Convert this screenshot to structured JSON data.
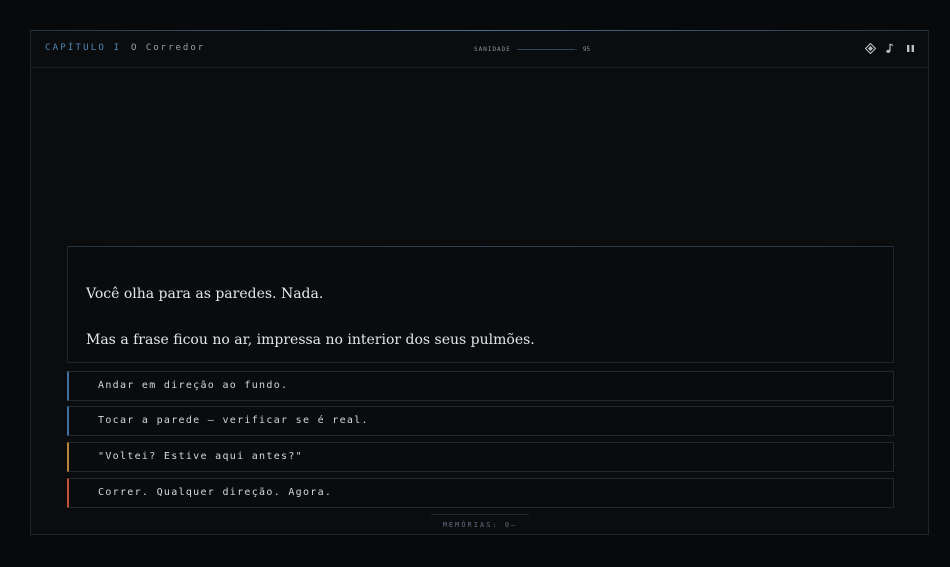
{
  "header": {
    "chapter_label": "CAPÍTULO I",
    "chapter_title": "O Corredor",
    "sanity_label": "SANIDADE",
    "sanity_value": "95",
    "sanity_fraction": 0.95,
    "icons": [
      "diamond-icon",
      "music-note-icon",
      "pause-icon"
    ]
  },
  "narrative": {
    "line1": "Você olha para as paredes. Nada.",
    "line2": "Mas a frase ficou no ar, impressa no interior dos seus pulmões."
  },
  "choices": [
    {
      "label": "Andar em direção ao fundo.",
      "accent": "#3e6f9e"
    },
    {
      "label": "Tocar a parede — verificar se é real.",
      "accent": "#3e6f9e"
    },
    {
      "label": "\"Voltei? Estive aqui antes?\"",
      "accent": "#b8853c"
    },
    {
      "label": "Correr. Qualquer direção. Agora.",
      "accent": "#c0503c"
    }
  ],
  "footer": {
    "memories": "MEMÓRIAS: 0—"
  },
  "colors": {
    "background": "#08090b",
    "panel": "#0b0c0e",
    "accent_blue": "#4f86b8",
    "text": "#e3e5e8"
  }
}
